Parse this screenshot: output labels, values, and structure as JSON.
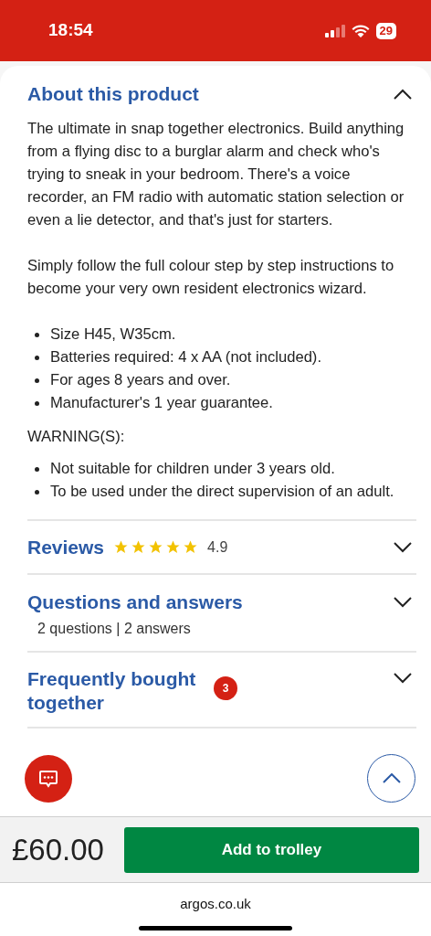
{
  "status_bar": {
    "time": "18:54",
    "battery": "29"
  },
  "sections": [
    {
      "kind": "about",
      "title": "About this product",
      "expanded": true,
      "paragraphs": [
        "The ultimate in snap together electronics. Build anything from a flying disc to a burglar alarm and check who's trying to sneak in your bedroom. There's a voice recorder, an FM radio with automatic station selection or even a lie detector, and that's just for starters.",
        "Simply follow the full colour step by step instructions to become your very own resident electronics wizard."
      ],
      "bullets": [
        "Size H45, W35cm.",
        "Batteries required: 4 x AA (not included).",
        "For ages 8 years and over.",
        "Manufacturer's 1 year guarantee."
      ],
      "warning_label": "WARNING(S):",
      "warnings": [
        "Not suitable for children under 3 years old.",
        "To be used under the direct supervision of an adult."
      ]
    },
    {
      "kind": "reviews",
      "title": "Reviews",
      "expanded": false,
      "stars": 5,
      "rating": "4.9"
    },
    {
      "kind": "qa",
      "title": "Questions and answers",
      "expanded": false,
      "subtitle": "2 questions | 2 answers"
    },
    {
      "kind": "bought",
      "title": "Frequently bought together",
      "expanded": false,
      "badge": "3"
    }
  ],
  "price": "£60.00",
  "add_button": "Add to trolley",
  "url": "argos.co.uk"
}
